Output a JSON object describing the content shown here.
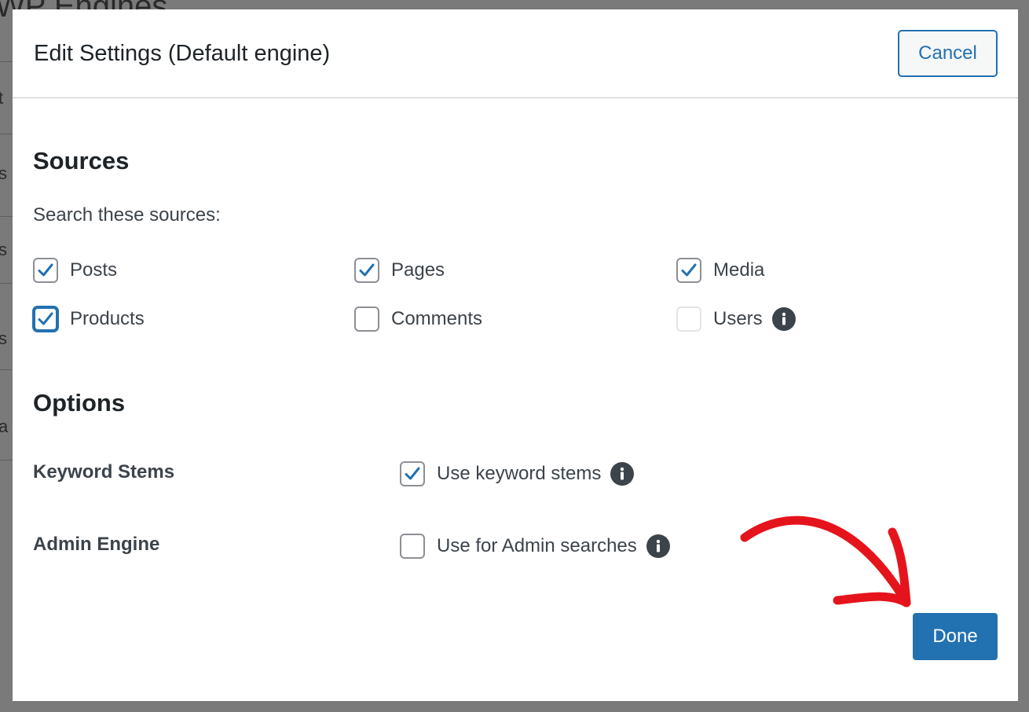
{
  "background": {
    "title_fragment": "WP Engines",
    "letters": [
      "t",
      "s c",
      "s",
      "s",
      "a"
    ]
  },
  "modal": {
    "title": "Edit Settings (Default engine)",
    "cancel_label": "Cancel",
    "done_label": "Done"
  },
  "sources": {
    "heading": "Sources",
    "prompt": "Search these sources:",
    "items": [
      {
        "label": "Posts",
        "checked": true
      },
      {
        "label": "Pages",
        "checked": true
      },
      {
        "label": "Media",
        "checked": true
      },
      {
        "label": "Products",
        "checked": true,
        "focused": true
      },
      {
        "label": "Comments",
        "checked": false
      },
      {
        "label": "Users",
        "checked": false,
        "disabled": true,
        "info": true
      }
    ]
  },
  "options": {
    "heading": "Options",
    "rows": [
      {
        "label": "Keyword Stems",
        "checkbox_label": "Use keyword stems",
        "checked": true
      },
      {
        "label": "Admin Engine",
        "checkbox_label": "Use for Admin searches",
        "checked": false
      }
    ]
  },
  "colors": {
    "accent": "#2271b1",
    "annotation_arrow": "#e5141c",
    "text": "#1d2327",
    "overlay": "#6b6b6b"
  },
  "icons": [
    "checkmark-icon",
    "info-icon",
    "red-arrow-annotation"
  ]
}
